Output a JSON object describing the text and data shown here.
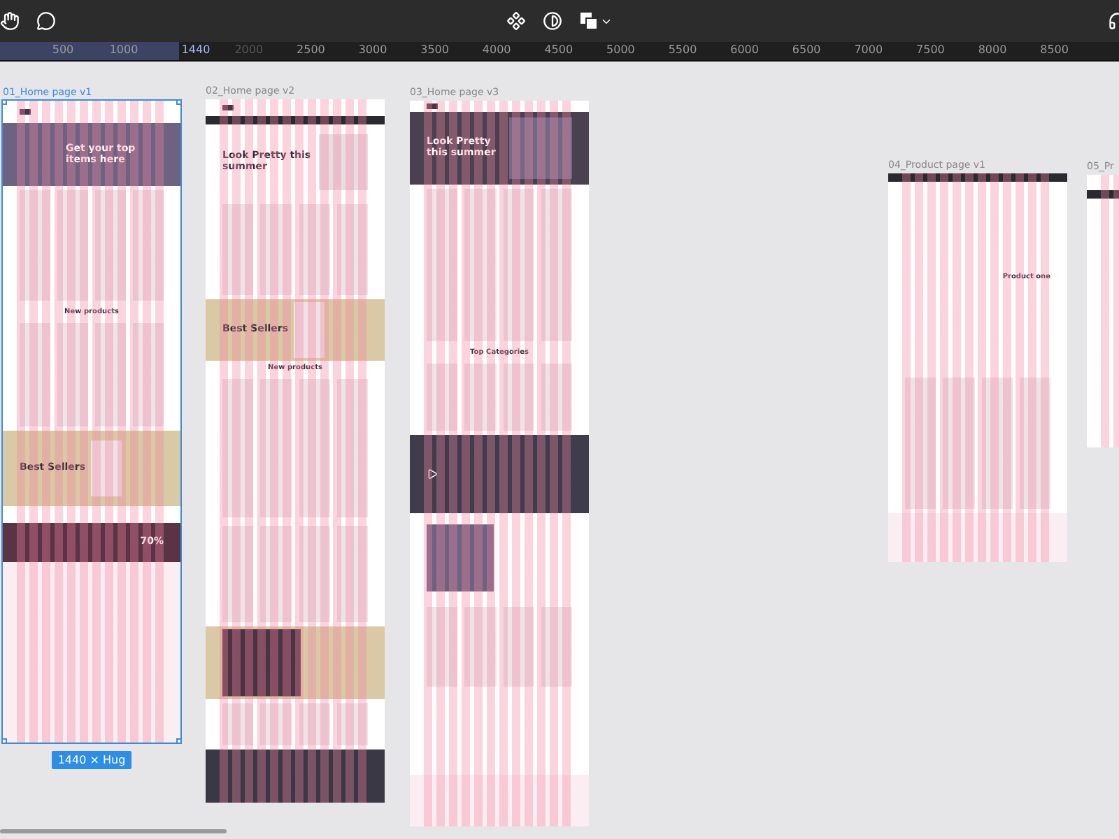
{
  "ruler": {
    "ticks": [
      {
        "label": "500",
        "kind": "normal"
      },
      {
        "label": "1000",
        "kind": "normal"
      },
      {
        "label": "1440",
        "kind": "edge"
      },
      {
        "label": "2000",
        "kind": "faint"
      },
      {
        "label": "2500",
        "kind": "normal"
      },
      {
        "label": "3000",
        "kind": "normal"
      },
      {
        "label": "3500",
        "kind": "normal"
      },
      {
        "label": "4000",
        "kind": "normal"
      },
      {
        "label": "4500",
        "kind": "normal"
      },
      {
        "label": "5000",
        "kind": "normal"
      },
      {
        "label": "5500",
        "kind": "normal"
      },
      {
        "label": "6000",
        "kind": "normal"
      },
      {
        "label": "6500",
        "kind": "normal"
      },
      {
        "label": "7000",
        "kind": "normal"
      },
      {
        "label": "7500",
        "kind": "normal"
      },
      {
        "label": "8000",
        "kind": "normal"
      },
      {
        "label": "8500",
        "kind": "normal"
      }
    ]
  },
  "frames": [
    {
      "label": "01_Home page v1",
      "selected": true,
      "size_label": "1440 × Hug",
      "sections": [
        {
          "kind": "nav"
        },
        {
          "kind": "hero-image",
          "heading": "Get your top items here"
        },
        {
          "kind": "products"
        },
        {
          "kind": "products",
          "heading": "New products"
        },
        {
          "kind": "promo",
          "heading": "Best Sellers"
        },
        {
          "kind": "plain"
        },
        {
          "kind": "banner",
          "heading": "70%"
        },
        {
          "kind": "footer-light"
        }
      ]
    },
    {
      "label": "02_Home page v2",
      "selected": false,
      "sections": [
        {
          "kind": "nav"
        },
        {
          "kind": "bar"
        },
        {
          "kind": "hero-light",
          "heading": "Look Pretty this summer"
        },
        {
          "kind": "products"
        },
        {
          "kind": "promo",
          "heading": "Best Sellers"
        },
        {
          "kind": "products",
          "heading": "New products"
        },
        {
          "kind": "products"
        },
        {
          "kind": "newsletter"
        },
        {
          "kind": "products"
        },
        {
          "kind": "footer-dark"
        }
      ]
    },
    {
      "label": "03_Home page v3",
      "selected": false,
      "sections": [
        {
          "kind": "nav"
        },
        {
          "kind": "hero-dark",
          "heading": "Look Pretty this summer"
        },
        {
          "kind": "products"
        },
        {
          "kind": "products",
          "heading": "Top Categories"
        },
        {
          "kind": "video"
        },
        {
          "kind": "feature"
        },
        {
          "kind": "products"
        },
        {
          "kind": "plain"
        },
        {
          "kind": "footer-light"
        }
      ]
    },
    {
      "label": "04_Product page v1",
      "selected": false,
      "sections": [
        {
          "kind": "bar"
        },
        {
          "kind": "product-detail",
          "heading": "Product one"
        },
        {
          "kind": "products"
        },
        {
          "kind": "footer-light"
        }
      ]
    },
    {
      "label": "05_Pr",
      "selected": false,
      "sections": [
        {
          "kind": "plain"
        },
        {
          "kind": "bar"
        },
        {
          "kind": "plain"
        }
      ]
    }
  ]
}
